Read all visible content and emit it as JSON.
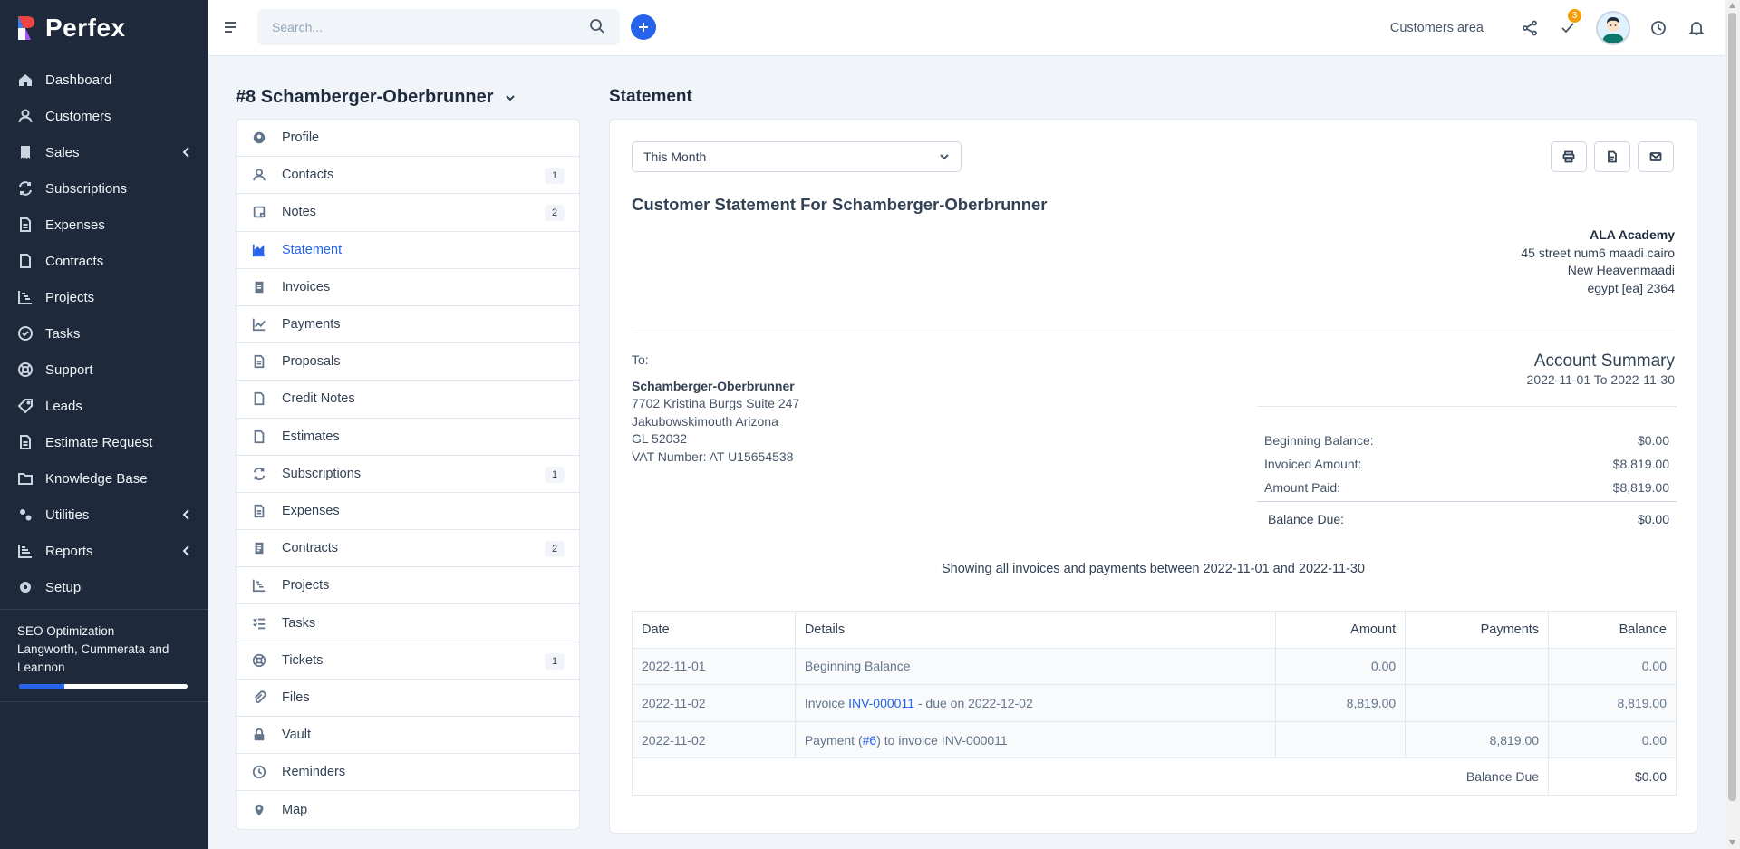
{
  "brand": {
    "name": "Perfex"
  },
  "sidebar": {
    "items": [
      {
        "label": "Dashboard",
        "icon": "home-icon",
        "chevron": false
      },
      {
        "label": "Customers",
        "icon": "user-icon",
        "chevron": false
      },
      {
        "label": "Sales",
        "icon": "receipt-icon",
        "chevron": true
      },
      {
        "label": "Subscriptions",
        "icon": "refresh-icon",
        "chevron": false
      },
      {
        "label": "Expenses",
        "icon": "document-icon",
        "chevron": false
      },
      {
        "label": "Contracts",
        "icon": "file-icon",
        "chevron": false
      },
      {
        "label": "Projects",
        "icon": "chart-steps-icon",
        "chevron": false
      },
      {
        "label": "Tasks",
        "icon": "check-circle-icon",
        "chevron": false
      },
      {
        "label": "Support",
        "icon": "lifebuoy-icon",
        "chevron": false
      },
      {
        "label": "Leads",
        "icon": "tag-icon",
        "chevron": false
      },
      {
        "label": "Estimate Request",
        "icon": "file-text-icon",
        "chevron": false
      },
      {
        "label": "Knowledge Base",
        "icon": "folder-icon",
        "chevron": false
      },
      {
        "label": "Utilities",
        "icon": "gears-icon",
        "chevron": true
      },
      {
        "label": "Reports",
        "icon": "bar-chart-icon",
        "chevron": true
      },
      {
        "label": "Setup",
        "icon": "gear-icon",
        "chevron": false
      }
    ],
    "project": {
      "title": "SEO Optimization",
      "client": "Langworth, Cummerata and Leannon",
      "progress": 0.27
    }
  },
  "topbar": {
    "search_placeholder": "Search...",
    "customers_area": "Customers area",
    "tasks_badge": "3"
  },
  "customer": {
    "title": "#8 Schamberger-Oberbrunner"
  },
  "customer_nav": [
    {
      "label": "Profile",
      "icon": "user-circle-icon",
      "count": ""
    },
    {
      "label": "Contacts",
      "icon": "user-icon",
      "count": "1"
    },
    {
      "label": "Notes",
      "icon": "note-icon",
      "count": "2"
    },
    {
      "label": "Statement",
      "icon": "area-chart-icon",
      "count": "",
      "active": true
    },
    {
      "label": "Invoices",
      "icon": "invoice-icon",
      "count": ""
    },
    {
      "label": "Payments",
      "icon": "line-chart-icon",
      "count": ""
    },
    {
      "label": "Proposals",
      "icon": "file-text-icon",
      "count": ""
    },
    {
      "label": "Credit Notes",
      "icon": "file-icon",
      "count": ""
    },
    {
      "label": "Estimates",
      "icon": "file-icon",
      "count": ""
    },
    {
      "label": "Subscriptions",
      "icon": "refresh-icon",
      "count": "1"
    },
    {
      "label": "Expenses",
      "icon": "file-text-icon",
      "count": ""
    },
    {
      "label": "Contracts",
      "icon": "contract-icon",
      "count": "2"
    },
    {
      "label": "Projects",
      "icon": "chart-steps-icon",
      "count": ""
    },
    {
      "label": "Tasks",
      "icon": "list-check-icon",
      "count": ""
    },
    {
      "label": "Tickets",
      "icon": "lifebuoy-icon",
      "count": "1"
    },
    {
      "label": "Files",
      "icon": "paperclip-icon",
      "count": ""
    },
    {
      "label": "Vault",
      "icon": "lock-icon",
      "count": ""
    },
    {
      "label": "Reminders",
      "icon": "clock-icon",
      "count": ""
    },
    {
      "label": "Map",
      "icon": "map-pin-icon",
      "count": ""
    }
  ],
  "statement": {
    "page_title": "Statement",
    "period": "This Month",
    "heading": "Customer Statement For Schamberger-Oberbrunner",
    "company": {
      "name": "ALA Academy",
      "line1": "45 street num6 maadi cairo",
      "line2": "New Heavenmaadi",
      "line3": "egypt [ea] 2364"
    },
    "to": {
      "label": "To:",
      "name": "Schamberger-Oberbrunner",
      "line1": "7702 Kristina Burgs Suite 247",
      "line2": "Jakubowskimouth Arizona",
      "line3": "GL 52032",
      "vat": "VAT Number: AT U15654538"
    },
    "summary": {
      "title": "Account Summary",
      "range": "2022-11-01 To 2022-11-30",
      "beginning_label": "Beginning Balance:",
      "beginning_value": "$0.00",
      "invoiced_label": "Invoiced Amount:",
      "invoiced_value": "$8,819.00",
      "paid_label": "Amount Paid:",
      "paid_value": "$8,819.00",
      "due_label": "Balance Due:",
      "due_value": "$0.00"
    },
    "showing": "Showing all invoices and payments between 2022-11-01 and 2022-11-30",
    "table": {
      "headers": {
        "date": "Date",
        "details": "Details",
        "amount": "Amount",
        "payments": "Payments",
        "balance": "Balance"
      },
      "rows": [
        {
          "date": "2022-11-01",
          "details_pre": "Beginning Balance",
          "details_link": "",
          "details_post": "",
          "amount": "0.00",
          "payments": "",
          "balance": "0.00"
        },
        {
          "date": "2022-11-02",
          "details_pre": "Invoice ",
          "details_link": "INV-000011",
          "details_post": " - due on 2022-12-02",
          "amount": "8,819.00",
          "payments": "",
          "balance": "8,819.00"
        },
        {
          "date": "2022-11-02",
          "details_pre": "Payment (",
          "details_link": "#6",
          "details_post": ") to invoice INV-000011",
          "amount": "",
          "payments": "8,819.00",
          "balance": "0.00"
        }
      ],
      "footer_label": "Balance Due",
      "footer_value": "$0.00"
    }
  },
  "colors": {
    "sidebar_bg": "#1e293b",
    "accent": "#2563eb",
    "badge": "#f59e0b"
  }
}
